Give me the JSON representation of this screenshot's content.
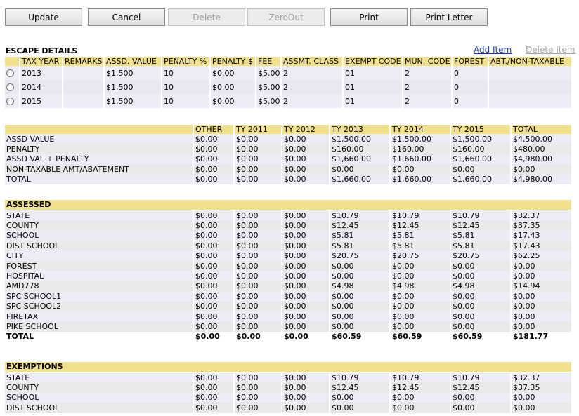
{
  "toolbar": {
    "update": "Update",
    "cancel": "Cancel",
    "delete": "Delete",
    "zeroout": "ZeroOut",
    "print": "Print",
    "print_letter": "Print Letter"
  },
  "escape": {
    "title": "ESCAPE DETAILS",
    "add_item": "Add Item",
    "delete_item": "Delete Item",
    "headers": [
      "",
      "TAX YEAR",
      "REMARKS",
      "ASSD. VALUE",
      "PENALTY %",
      "PENALTY $",
      "FEE",
      "ASSMT. CLASS",
      "EXEMPT CODE",
      "MUN. CODE",
      "FOREST",
      "ABT./NON-TAXABLE"
    ],
    "rows": [
      [
        "2013",
        "",
        "$1,500",
        "10",
        "$0.00",
        "$5.00",
        "2",
        "01",
        "2",
        "0",
        ""
      ],
      [
        "2014",
        "",
        "$1,500",
        "10",
        "$0.00",
        "$5.00",
        "2",
        "01",
        "2",
        "0",
        ""
      ],
      [
        "2015",
        "",
        "$1,500",
        "10",
        "$0.00",
        "$5.00",
        "2",
        "01",
        "2",
        "0",
        ""
      ]
    ]
  },
  "summary": {
    "headers": [
      "",
      "OTHER",
      "TY 2011",
      "TY 2012",
      "TY 2013",
      "TY 2014",
      "TY 2015",
      "TOTAL"
    ],
    "rows": [
      [
        "ASSD VALUE",
        "$0.00",
        "$0.00",
        "$0.00",
        "$1,500.00",
        "$1,500.00",
        "$1,500.00",
        "$4,500.00"
      ],
      [
        "PENALTY",
        "$0.00",
        "$0.00",
        "$0.00",
        "$160.00",
        "$160.00",
        "$160.00",
        "$480.00"
      ],
      [
        "ASSD VAL + PENALTY",
        "$0.00",
        "$0.00",
        "$0.00",
        "$1,660.00",
        "$1,660.00",
        "$1,660.00",
        "$4,980.00"
      ],
      [
        "NON-TAXABLE AMT/ABATEMENT",
        "$0.00",
        "$0.00",
        "$0.00",
        "$0.00",
        "$0.00",
        "$0.00",
        "$0.00"
      ],
      [
        "TOTAL",
        "$0.00",
        "$0.00",
        "$0.00",
        "$1,660.00",
        "$1,660.00",
        "$1,660.00",
        "$4,980.00"
      ]
    ]
  },
  "assessed": {
    "title": "ASSESSED",
    "rows": [
      [
        "STATE",
        "$0.00",
        "$0.00",
        "$0.00",
        "$10.79",
        "$10.79",
        "$10.79",
        "$32.37"
      ],
      [
        "COUNTY",
        "$0.00",
        "$0.00",
        "$0.00",
        "$12.45",
        "$12.45",
        "$12.45",
        "$37.35"
      ],
      [
        "SCHOOL",
        "$0.00",
        "$0.00",
        "$0.00",
        "$5.81",
        "$5.81",
        "$5.81",
        "$17.43"
      ],
      [
        "DIST SCHOOL",
        "$0.00",
        "$0.00",
        "$0.00",
        "$5.81",
        "$5.81",
        "$5.81",
        "$17.43"
      ],
      [
        "CITY",
        "$0.00",
        "$0.00",
        "$0.00",
        "$20.75",
        "$20.75",
        "$20.75",
        "$62.25"
      ],
      [
        "FOREST",
        "$0.00",
        "$0.00",
        "$0.00",
        "$0.00",
        "$0.00",
        "$0.00",
        "$0.00"
      ],
      [
        "HOSPITAL",
        "$0.00",
        "$0.00",
        "$0.00",
        "$0.00",
        "$0.00",
        "$0.00",
        "$0.00"
      ],
      [
        "AMD778",
        "$0.00",
        "$0.00",
        "$0.00",
        "$4.98",
        "$4.98",
        "$4.98",
        "$14.94"
      ],
      [
        "SPC SCHOOL1",
        "$0.00",
        "$0.00",
        "$0.00",
        "$0.00",
        "$0.00",
        "$0.00",
        "$0.00"
      ],
      [
        "SPC SCHOOL2",
        "$0.00",
        "$0.00",
        "$0.00",
        "$0.00",
        "$0.00",
        "$0.00",
        "$0.00"
      ],
      [
        "FIRETAX",
        "$0.00",
        "$0.00",
        "$0.00",
        "$0.00",
        "$0.00",
        "$0.00",
        "$0.00"
      ],
      [
        "PIKE SCHOOL",
        "$0.00",
        "$0.00",
        "$0.00",
        "$0.00",
        "$0.00",
        "$0.00",
        "$0.00"
      ]
    ],
    "total": [
      "TOTAL",
      "$0.00",
      "$0.00",
      "$0.00",
      "$60.59",
      "$60.59",
      "$60.59",
      "$181.77"
    ]
  },
  "exemptions": {
    "title": "EXEMPTIONS",
    "rows": [
      [
        "STATE",
        "$0.00",
        "$0.00",
        "$0.00",
        "$10.79",
        "$10.79",
        "$10.79",
        "$32.37"
      ],
      [
        "COUNTY",
        "$0.00",
        "$0.00",
        "$0.00",
        "$12.45",
        "$12.45",
        "$12.45",
        "$37.35"
      ],
      [
        "SCHOOL",
        "$0.00",
        "$0.00",
        "$0.00",
        "$0.00",
        "$0.00",
        "$0.00",
        "$0.00"
      ],
      [
        "DIST SCHOOL",
        "$0.00",
        "$0.00",
        "$0.00",
        "$0.00",
        "$0.00",
        "$0.00",
        "$0.00"
      ]
    ]
  }
}
